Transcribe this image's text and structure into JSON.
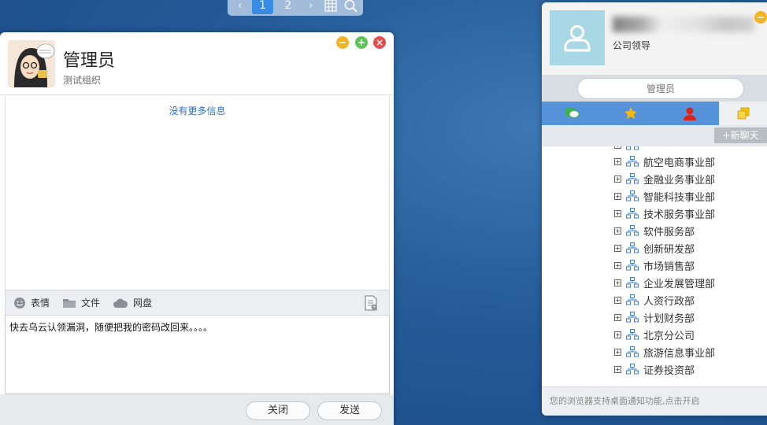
{
  "pager": {
    "prev": "‹",
    "pages": [
      "1",
      "2"
    ],
    "next": "›"
  },
  "chat": {
    "title": "管理员",
    "subtitle": "测试组织",
    "no_more_info": "没有更多信息",
    "tools": {
      "emoji": "表情",
      "file": "文件",
      "netdisk": "网盘"
    },
    "message_text": "快去乌云认领漏洞，随便把我的密码改回来。。。。",
    "close_label": "关闭",
    "send_label": "发送"
  },
  "panel": {
    "user_role": "公司领导",
    "search_placeholder": "管理员",
    "new_chat_label": "+新聊天",
    "departments": [
      "航空电商事业部",
      "金融业务事业部",
      "智能科技事业部",
      "技术服务事业部",
      "软件服务部",
      "创新研发部",
      "市场销售部",
      "企业发展管理部",
      "人资行政部",
      "计划财务部",
      "北京分公司",
      "旅游信息事业部",
      "证券投资部"
    ],
    "footer_notice": "您的浏览器支持桌面通知功能,点击开启"
  },
  "colors": {
    "tab_bar": "#5592d9",
    "accent_blue": "#3a8ee6",
    "min": "#f0b429",
    "max": "#5cc456",
    "close": "#e64c4c"
  }
}
